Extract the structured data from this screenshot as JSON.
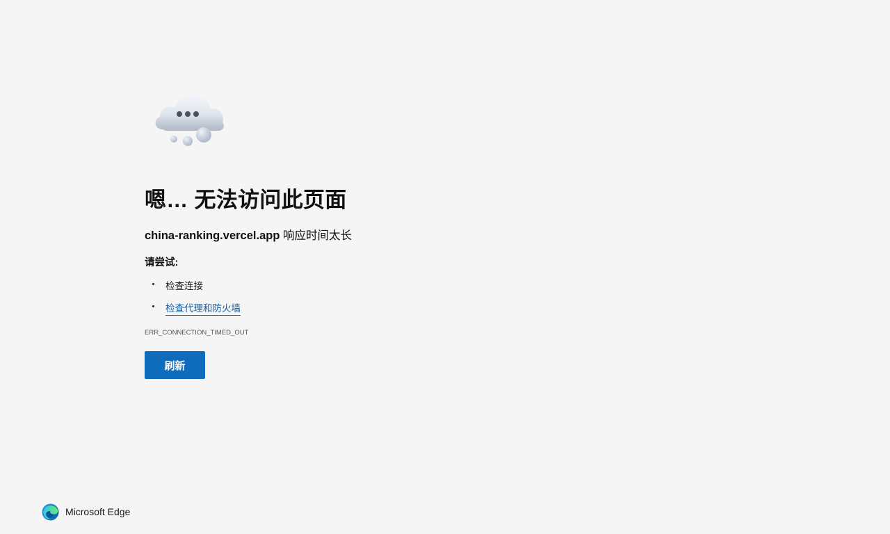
{
  "main": {
    "illustration": "thinking-cloud-icon",
    "title": "嗯… 无法访问此页面",
    "error_summary": {
      "host": "china-ranking.vercel.app",
      "message": " 响应时间太长"
    },
    "try_heading": "请尝试:",
    "suggestions": [
      {
        "label": "检查连接",
        "is_link": false
      },
      {
        "label": "检查代理和防火墙",
        "is_link": true
      }
    ],
    "error_code": "ERR_CONNECTION_TIMED_OUT",
    "refresh_label": "刷新"
  },
  "footer": {
    "logo": "edge-logo-icon",
    "brand": "Microsoft Edge"
  },
  "colors": {
    "background": "#f5f5f5",
    "accent_button": "#0f6cbd",
    "link": "#0f5fa8"
  }
}
